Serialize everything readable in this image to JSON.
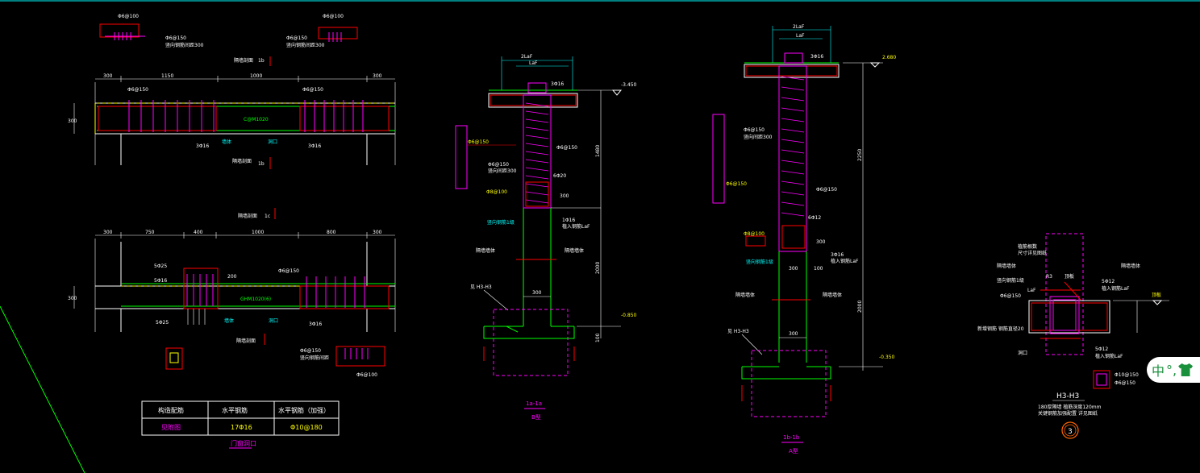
{
  "colors": {
    "background": "#000000",
    "frame": "#00ffff",
    "wall": "#ffffff",
    "rebar": "#ff00ff",
    "dim": "#ffff00",
    "fill": "#00ff00",
    "red": "#ff0000"
  },
  "plan_top": {
    "rebar_top": "Φ6@100",
    "rebar_mid": "Φ6@100",
    "stirrup_note": "Φ6@150",
    "stirrup_note2": "竖向钢筋间距300",
    "marker_1b": "1b",
    "dims": [
      "300",
      "1150",
      "1000",
      "300"
    ],
    "dim_height": "300",
    "stirrup_left": "Φ6@150",
    "stirrup_right": "Φ6@150",
    "center_label": "C@M1020",
    "bar_left": "3Φ16",
    "bar_right": "3Φ16",
    "label_wall": "墙体",
    "label_opening": "洞口",
    "section_tag": "隔墙剖面"
  },
  "plan_bottom": {
    "section_tag": "隔墙剖面",
    "marker_1c": "1c",
    "dims": [
      "300",
      "750",
      "400",
      "1000",
      "800",
      "300"
    ],
    "dim_height": "300",
    "dim_col": "200",
    "bars_5a": "5Φ25",
    "bars_5b": "5Φ16",
    "bars_5c": "5Φ25",
    "stirrup_right": "Φ6@150",
    "center_label": "GHM1020(6)",
    "bar_right": "3Φ16",
    "label_opening": "洞口",
    "rebar_note": "Φ6@150",
    "rebar_note2": "竖向钢筋间距",
    "rebar_bottom": "Φ6@100"
  },
  "table": {
    "headers": [
      "构造配筋",
      "水平钢筋",
      "水平钢筋（加强）"
    ],
    "row": [
      "见附图",
      "17Φ16",
      "Φ10@180"
    ],
    "caption": "门窗洞口"
  },
  "section_1a": {
    "top_dim": "2LaF",
    "top_dim2": "LaF",
    "elev_top": "-3.450",
    "label_bar": "3Φ16",
    "stirrup": "Φ6@150",
    "stirrup2": "Φ6@150",
    "spacing": "竖向间距300",
    "dim_6": "6Φ20",
    "dim_300": "300",
    "bar_1_label": "Φ6@150",
    "bar_2_label": "Φ8@100",
    "ref_a": "竖向钢筋1级",
    "ref_b": "1Φ16",
    "ref_c": "植入钢筋LaF",
    "dim_1480": "1480",
    "dim_2000": "2000",
    "label_left": "隔墙墙体",
    "label_right": "隔墙墙体",
    "detail_ref": "见 H3-H3",
    "dim_300b": "300",
    "elev_bottom": "-0.850",
    "dim_100": "100",
    "title": "1a-1a",
    "subtitle": "B型"
  },
  "section_1b": {
    "top_dim": "2LaF",
    "top_dim2": "LaF",
    "elev_top": "2.680",
    "label_bar": "3Φ16",
    "stirrup": "Φ6@150",
    "spacing": "竖向间距300",
    "bar_label": "Φ6@150",
    "stirrup_right": "Φ6@150",
    "dim_2250": "2250",
    "dim_6": "6Φ12",
    "bar_2_label": "Φ8@100",
    "dim_300": "300",
    "ref_a": "3Φ16",
    "ref_b": "植入钢筋LaF",
    "ref_c": "竖向钢筋1级",
    "dim_300b": "300",
    "dim_100": "100",
    "label_left": "隔墙墙体",
    "label_right": "隔墙墙体",
    "dim_2000": "2000",
    "detail_ref": "见 H3-H3",
    "dim_300c": "300",
    "elev_bottom": "-0.350",
    "title": "1b-1b",
    "subtitle": "A型"
  },
  "detail_h3": {
    "label_top_a": "植筋根数",
    "label_top_b": "尺寸详见图纸",
    "label_left": "隔墙墙体",
    "label_right": "隔墙墙体",
    "ring": "竖向钢筋1级",
    "bar_lead": "Φ6@150",
    "laf": "LaF",
    "r": "R3",
    "top": "顶板",
    "bars_top": "5Φ12",
    "bars_top2": "植入钢筋LaF",
    "note_left": "新增钢筋 钢筋直径20",
    "bars_bottom": "5Φ12",
    "bars_bottom2": "植入钢筋LaF",
    "label_bottom": "洞口",
    "label_dim": "顶板",
    "legend_a": "Φ10@150",
    "legend_b": "Φ6@150",
    "title": "H3-H3",
    "note1": "180厚隔墙 植筋深度120mm",
    "note2": "关键钢筋加强配置 详见图纸",
    "circle_num": "3"
  },
  "ime": {
    "label": "中",
    "punct": "°,"
  }
}
